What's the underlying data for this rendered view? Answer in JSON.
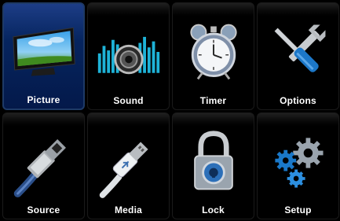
{
  "menu": {
    "items": [
      {
        "label": "Picture",
        "icon": "tv-icon",
        "selected": true
      },
      {
        "label": "Sound",
        "icon": "speaker-equalizer-icon",
        "selected": false
      },
      {
        "label": "Timer",
        "icon": "alarm-clock-icon",
        "selected": false
      },
      {
        "label": "Options",
        "icon": "wrench-screwdriver-icon",
        "selected": false
      },
      {
        "label": "Source",
        "icon": "hdmi-cable-icon",
        "selected": false
      },
      {
        "label": "Media",
        "icon": "usb-cable-icon",
        "selected": false
      },
      {
        "label": "Lock",
        "icon": "padlock-icon",
        "selected": false
      },
      {
        "label": "Setup",
        "icon": "gears-icon",
        "selected": false
      }
    ]
  },
  "colors": {
    "selected_tile": "#06255f",
    "label": "#ffffff",
    "background": "#000000"
  }
}
